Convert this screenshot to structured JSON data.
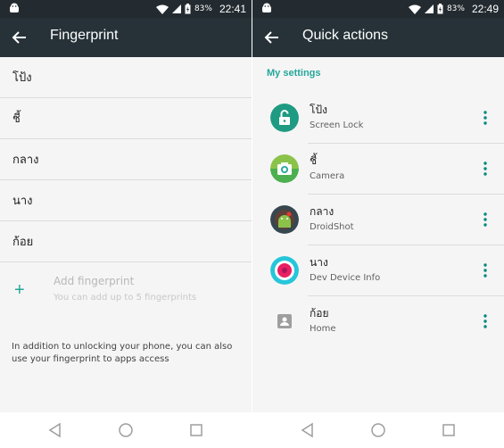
{
  "status_left": {
    "battery_percent": "83%",
    "time": "22:41"
  },
  "status_right": {
    "battery_percent": "83%",
    "time": "22:49"
  },
  "fingerprint": {
    "title": "Fingerprint",
    "items": [
      {
        "label": "โป้ง"
      },
      {
        "label": "ชี้"
      },
      {
        "label": "กลาง"
      },
      {
        "label": "นาง"
      },
      {
        "label": "ก้อย"
      }
    ],
    "add": {
      "icon": "plus-icon",
      "title": "Add fingerprint",
      "subtitle": "You can add up to 5 fingerprints"
    },
    "info": "In addition to unlocking your phone, you can also use your fingerprint to apps access"
  },
  "quick_actions": {
    "title": "Quick actions",
    "section": "My settings",
    "items": [
      {
        "name": "โป้ง",
        "app": "Screen Lock",
        "icon": "unlock-icon",
        "color": "#1e9b82"
      },
      {
        "name": "ชี้",
        "app": "Camera",
        "icon": "camera-icon",
        "color": "#8bc34a"
      },
      {
        "name": "กลาง",
        "app": "DroidShot",
        "icon": "droidshot-icon",
        "color": "#37474f"
      },
      {
        "name": "นาง",
        "app": "Dev Device Info",
        "icon": "dev-device-info-icon",
        "color": "#26c6da"
      },
      {
        "name": "ก้อย",
        "app": "Home",
        "icon": "home-icon",
        "color": "#9e9e9e"
      }
    ]
  },
  "colors": {
    "toolbar": "#263238",
    "statusbar": "#232b30",
    "accent": "#26a69a",
    "menu": "#00897b"
  }
}
